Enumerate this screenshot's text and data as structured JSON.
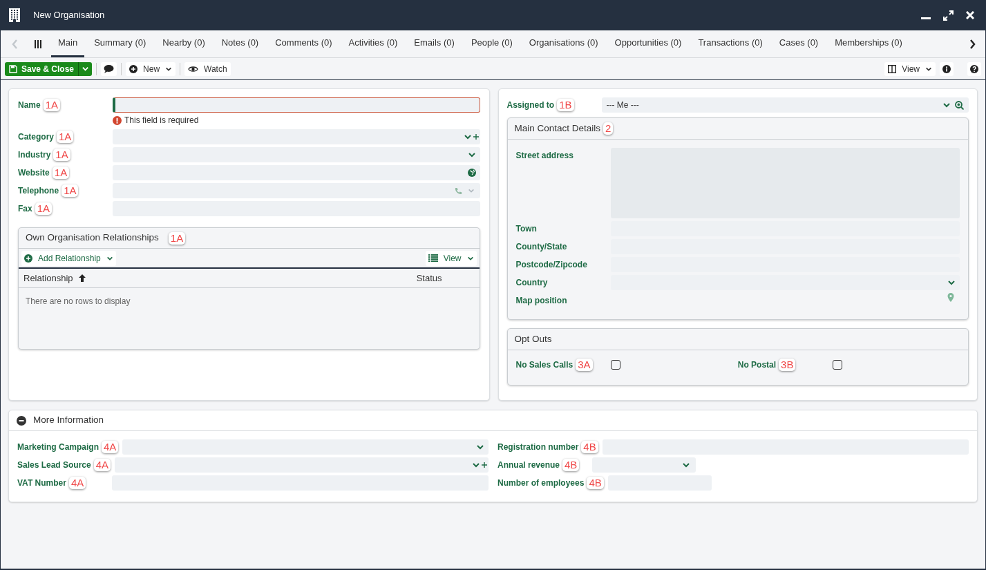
{
  "window": {
    "title": "New Organisation"
  },
  "tabs": [
    {
      "label": "Main",
      "selected": true
    },
    {
      "label": "Summary (0)",
      "selected": false
    },
    {
      "label": "Nearby (0)",
      "selected": false
    },
    {
      "label": "Notes (0)",
      "selected": false
    },
    {
      "label": "Comments (0)",
      "selected": false
    },
    {
      "label": "Activities (0)",
      "selected": false
    },
    {
      "label": "Emails (0)",
      "selected": false
    },
    {
      "label": "People (0)",
      "selected": false
    },
    {
      "label": "Organisations (0)",
      "selected": false
    },
    {
      "label": "Opportunities (0)",
      "selected": false
    },
    {
      "label": "Transactions (0)",
      "selected": false
    },
    {
      "label": "Cases (0)",
      "selected": false
    },
    {
      "label": "Memberships (0)",
      "selected": false
    }
  ],
  "toolbar": {
    "save_label": "Save & Close",
    "new_label": "New",
    "watch_label": "Watch",
    "view_label": "View"
  },
  "main_fields": [
    {
      "label": "Name",
      "badge": "1A",
      "kind": "text",
      "error": "This field is required"
    },
    {
      "label": "Category",
      "badge": "1A",
      "kind": "select_add"
    },
    {
      "label": "Industry",
      "badge": "1A",
      "kind": "select"
    },
    {
      "label": "Website",
      "badge": "1A",
      "kind": "url"
    },
    {
      "label": "Telephone",
      "badge": "1A",
      "kind": "phone"
    },
    {
      "label": "Fax",
      "badge": "1A",
      "kind": "text"
    }
  ],
  "relationships": {
    "title": "Own Organisation Relationships",
    "badge": "1A",
    "add_label": "Add Relationship",
    "view_label": "View",
    "columns": [
      "Relationship",
      "Status"
    ],
    "empty_text": "There are no rows to display"
  },
  "assigned": {
    "label": "Assigned to",
    "badge": "1B",
    "value": "--- Me ---"
  },
  "contact": {
    "title": "Main Contact Details",
    "badge": "2",
    "fields": [
      {
        "label": "Street address",
        "kind": "textarea"
      },
      {
        "label": "Town",
        "kind": "text"
      },
      {
        "label": "County/State",
        "kind": "text"
      },
      {
        "label": "Postcode/Zipcode",
        "kind": "text"
      },
      {
        "label": "Country",
        "kind": "select"
      },
      {
        "label": "Map position",
        "kind": "map"
      }
    ]
  },
  "opt_outs": {
    "title": "Opt Outs",
    "items": [
      {
        "label": "No Sales Calls",
        "badge": "3A",
        "checked": false
      },
      {
        "label": "No Postal",
        "badge": "3B",
        "checked": false
      }
    ]
  },
  "more_info": {
    "title": "More Information",
    "expanded": true,
    "left": [
      {
        "label": "Marketing Campaign",
        "badge": "4A",
        "kind": "select"
      },
      {
        "label": "Sales Lead Source",
        "badge": "4A",
        "kind": "select_add"
      },
      {
        "label": "VAT Number",
        "badge": "4A",
        "kind": "text"
      }
    ],
    "right": [
      {
        "label": "Registration number",
        "badge": "4B",
        "kind": "text"
      },
      {
        "label": "Annual revenue",
        "badge": "4B",
        "kind": "select_short"
      },
      {
        "label": "Number of employees",
        "badge": "4B",
        "kind": "text_short"
      }
    ]
  }
}
